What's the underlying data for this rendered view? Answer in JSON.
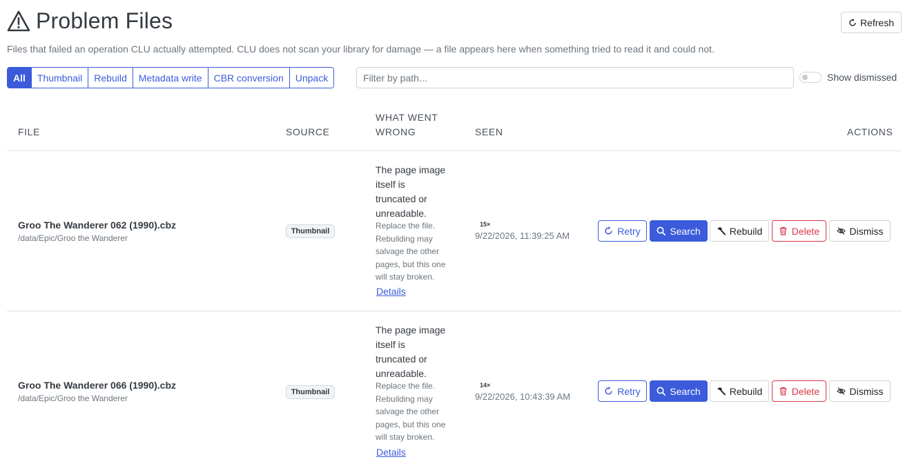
{
  "header": {
    "title": "Problem Files",
    "refresh_label": "Refresh",
    "subtitle": "Files that failed an operation CLU actually attempted. CLU does not scan your library for damage — a file appears here when something tried to read it and could not."
  },
  "filters": {
    "tabs": [
      "All",
      "Thumbnail",
      "Rebuild",
      "Metadata write",
      "CBR conversion",
      "Unpack"
    ],
    "active": "All",
    "path_placeholder": "Filter by path...",
    "path_value": "",
    "show_dismissed_label": "Show dismissed",
    "show_dismissed": false
  },
  "table": {
    "columns": {
      "file": "FILE",
      "source": "SOURCE",
      "what_line1": "WHAT WENT",
      "what_line2": "WRONG",
      "seen": "SEEN",
      "actions": "ACTIONS"
    },
    "rows": [
      {
        "file_name": "Groo The Wanderer 062 (1990).cbz",
        "file_path": "/data/Epic/Groo the Wanderer",
        "source": "Thumbnail",
        "error_lines": [
          "The page image",
          "itself is",
          "truncated or",
          "unreadable."
        ],
        "hint_lines": [
          "Replace the file.",
          "Rebuilding may",
          "salvage the other",
          "pages, but this one",
          "will stay broken."
        ],
        "details_label": "Details",
        "count": "15×",
        "seen": "9/22/2026, 11:39:25 AM"
      },
      {
        "file_name": "Groo The Wanderer 066 (1990).cbz",
        "file_path": "/data/Epic/Groo the Wanderer",
        "source": "Thumbnail",
        "error_lines": [
          "The page image",
          "itself is",
          "truncated or",
          "unreadable."
        ],
        "hint_lines": [
          "Replace the file.",
          "Rebuilding may",
          "salvage the other",
          "pages, but this one",
          "will stay broken."
        ],
        "details_label": "Details",
        "count": "14×",
        "seen": "9/22/2026, 10:43:39 AM"
      }
    ]
  },
  "actions": {
    "retry": "Retry",
    "search": "Search",
    "rebuild": "Rebuild",
    "delete": "Delete",
    "dismiss": "Dismiss"
  },
  "icons": {
    "title": "warning-triangle-icon",
    "refresh": "refresh-icon",
    "retry": "refresh-icon",
    "search": "search-icon",
    "rebuild": "hammer-icon",
    "delete": "trash-icon",
    "dismiss": "eye-slash-icon"
  },
  "colors": {
    "primary": "#3b5bdb",
    "danger": "#dc3545",
    "muted": "#6c757d",
    "border": "#dee2e6"
  }
}
